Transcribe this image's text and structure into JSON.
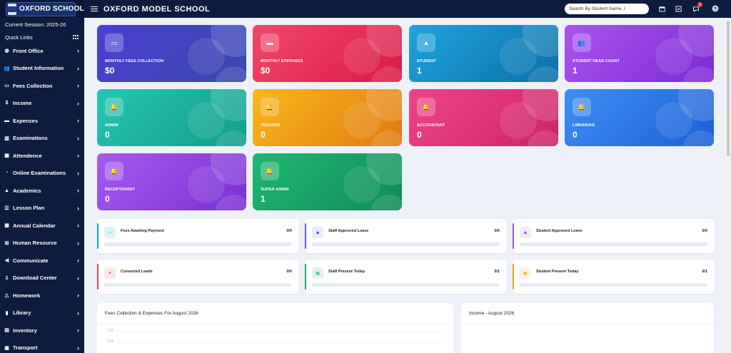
{
  "app": {
    "logo_text": "OXFORD SCHOOL",
    "school_name": "OXFORD MODEL SCHOOL",
    "session": "Current Session: 2025-26",
    "quick_links": "Quick Links"
  },
  "header": {
    "search_value": "Search By Student Name, I",
    "icons": [
      "calendar-icon",
      "task-icon",
      "chat-icon",
      "help-icon"
    ],
    "chat_badge": "0"
  },
  "sidebar": {
    "items": [
      {
        "label": "Front Office",
        "icon": "globe-icon"
      },
      {
        "label": "Student Information",
        "icon": "users-icon"
      },
      {
        "label": "Fees Collection",
        "icon": "money-icon"
      },
      {
        "label": "Income",
        "icon": "dollar-icon"
      },
      {
        "label": "Expenses",
        "icon": "card-icon"
      },
      {
        "label": "Examinations",
        "icon": "map-icon"
      },
      {
        "label": "Attendence",
        "icon": "calendar-check-icon"
      },
      {
        "label": "Online Examinations",
        "icon": "rss-icon"
      },
      {
        "label": "Academics",
        "icon": "graduation-cap-icon"
      },
      {
        "label": "Lesson Plan",
        "icon": "list-icon"
      },
      {
        "label": "Annual Calendar",
        "icon": "calendar-icon"
      },
      {
        "label": "Human Resource",
        "icon": "sitemap-icon"
      },
      {
        "label": "Communicate",
        "icon": "bullhorn-icon"
      },
      {
        "label": "Download Center",
        "icon": "download-icon"
      },
      {
        "label": "Homework",
        "icon": "flask-icon"
      },
      {
        "label": "Library",
        "icon": "book-icon"
      },
      {
        "label": "Inventory",
        "icon": "inventory-icon"
      },
      {
        "label": "Transport",
        "icon": "bus-icon"
      }
    ]
  },
  "stats": [
    {
      "label": "MONTHLY FEES COLLECTION",
      "value": "$0",
      "icon": "money-icon",
      "gradient": [
        "#4b3fd6",
        "#3949ab"
      ]
    },
    {
      "label": "MONTHLY EXPENSES",
      "value": "$0",
      "icon": "card-icon",
      "gradient": [
        "#f2476a",
        "#d81b46"
      ]
    },
    {
      "label": "STUDENT",
      "value": "1",
      "icon": "graduation-cap-icon",
      "gradient": [
        "#1ea5dc",
        "#0b6fa8"
      ]
    },
    {
      "label": "STUDENT HEAD COUNT",
      "value": "1",
      "icon": "users-icon",
      "gradient": [
        "#a955f0",
        "#7b2ad6"
      ]
    },
    {
      "label": "ADMIN",
      "value": "0",
      "icon": "bell-icon",
      "gradient": [
        "#26c6b3",
        "#119e8a"
      ]
    },
    {
      "label": "TEACHER",
      "value": "0",
      "icon": "bell-icon",
      "gradient": [
        "#f9b91c",
        "#e07a10"
      ]
    },
    {
      "label": "ACCOUNTANT",
      "value": "0",
      "icon": "bell-icon",
      "gradient": [
        "#f0438a",
        "#cc2468"
      ]
    },
    {
      "label": "LIBRARIAN",
      "value": "0",
      "icon": "bell-icon",
      "gradient": [
        "#3f8ef5",
        "#1d5fd8"
      ]
    },
    {
      "label": "RECEPTIONIST",
      "value": "0",
      "icon": "bell-icon",
      "gradient": [
        "#a65bf0",
        "#7a2fd4"
      ]
    },
    {
      "label": "SUPER ADMIN",
      "value": "1",
      "icon": "bell-icon",
      "gradient": [
        "#20b874",
        "#0f8b57"
      ]
    }
  ],
  "progress": [
    {
      "label": "Fees Awaiting Payment",
      "count": "0/0",
      "fraction": 0,
      "color": "#19a7c9",
      "icon": "money-icon"
    },
    {
      "label": "Staff Approved Leave",
      "count": "0/0",
      "fraction": 0,
      "color": "#5b5fd8",
      "icon": "leaf-icon"
    },
    {
      "label": "Student Approved Leave",
      "count": "0/0",
      "fraction": 0,
      "color": "#9b59d6",
      "icon": "leaf-icon"
    },
    {
      "label": "Converted Leads",
      "count": "0/0",
      "fraction": 0,
      "color": "#e0485c",
      "icon": "lead-icon"
    },
    {
      "label": "Staff Present Today",
      "count": "0/1",
      "fraction": 0,
      "color": "#1fa873",
      "icon": "calendar-check-icon"
    },
    {
      "label": "Student Present Today",
      "count": "0/1",
      "fraction": 0,
      "color": "#e8a617",
      "icon": "calendar-check-icon"
    }
  ],
  "panels": {
    "fees_title": "Fees Collection & Expenses For August 2026",
    "income_title": "Income - August 2026",
    "axis_labels": [
      "1.0",
      "0.8"
    ]
  }
}
